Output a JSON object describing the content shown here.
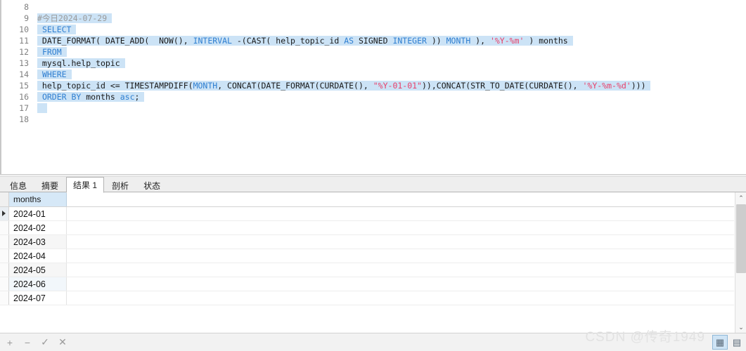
{
  "editor": {
    "first_line_number": 8,
    "lines": [
      {
        "num": 8,
        "selected": false,
        "tokens": []
      },
      {
        "num": 9,
        "selected": true,
        "tokens": [
          {
            "t": "#今日2024-07-29",
            "c": "comment"
          }
        ]
      },
      {
        "num": 10,
        "selected": true,
        "tokens": [
          {
            "t": " ",
            "c": "plain"
          },
          {
            "t": "SELECT",
            "c": "kw"
          }
        ]
      },
      {
        "num": 11,
        "selected": true,
        "tokens": [
          {
            "t": " DATE_FORMAT( DATE_ADD(  NOW(), ",
            "c": "plain"
          },
          {
            "t": "INTERVAL",
            "c": "kw"
          },
          {
            "t": " -(CAST( help_topic_id ",
            "c": "plain"
          },
          {
            "t": "AS",
            "c": "kw"
          },
          {
            "t": " SIGNED ",
            "c": "plain"
          },
          {
            "t": "INTEGER",
            "c": "kw"
          },
          {
            "t": " )) ",
            "c": "plain"
          },
          {
            "t": "MONTH",
            "c": "kw"
          },
          {
            "t": " ), ",
            "c": "plain"
          },
          {
            "t": "'%Y-%m'",
            "c": "str"
          },
          {
            "t": " ) months",
            "c": "plain"
          }
        ]
      },
      {
        "num": 12,
        "selected": true,
        "tokens": [
          {
            "t": " ",
            "c": "plain"
          },
          {
            "t": "FROM",
            "c": "kw"
          }
        ]
      },
      {
        "num": 13,
        "selected": true,
        "tokens": [
          {
            "t": " mysql.help_topic",
            "c": "plain"
          }
        ]
      },
      {
        "num": 14,
        "selected": true,
        "tokens": [
          {
            "t": " ",
            "c": "plain"
          },
          {
            "t": "WHERE",
            "c": "kw"
          }
        ]
      },
      {
        "num": 15,
        "selected": true,
        "tokens": [
          {
            "t": " help_topic_id <= TIMESTAMPDIFF(",
            "c": "plain"
          },
          {
            "t": "MONTH",
            "c": "kw"
          },
          {
            "t": ", CONCAT(DATE_FORMAT(CURDATE(), ",
            "c": "plain"
          },
          {
            "t": "\"%Y-01-01\"",
            "c": "str"
          },
          {
            "t": ")),CONCAT(STR_TO_DATE(CURDATE(), ",
            "c": "plain"
          },
          {
            "t": "'%Y-%m-%d'",
            "c": "str"
          },
          {
            "t": ")))",
            "c": "plain"
          }
        ]
      },
      {
        "num": 16,
        "selected": true,
        "tokens": [
          {
            "t": " ",
            "c": "plain"
          },
          {
            "t": "ORDER BY",
            "c": "kw"
          },
          {
            "t": " months ",
            "c": "plain"
          },
          {
            "t": "asc",
            "c": "kw"
          },
          {
            "t": ";",
            "c": "plain"
          }
        ]
      },
      {
        "num": 17,
        "selected": true,
        "tokens": []
      },
      {
        "num": 18,
        "selected": false,
        "tokens": []
      }
    ]
  },
  "tabs": [
    {
      "label": "信息",
      "active": false
    },
    {
      "label": "摘要",
      "active": false
    },
    {
      "label": "结果 1",
      "active": true
    },
    {
      "label": "剖析",
      "active": false
    },
    {
      "label": "状态",
      "active": false
    }
  ],
  "result_grid": {
    "columns": [
      "months"
    ],
    "rows": [
      {
        "values": [
          "2024-01"
        ],
        "current": true
      },
      {
        "values": [
          "2024-02"
        ],
        "current": false
      },
      {
        "values": [
          "2024-03"
        ],
        "current": false
      },
      {
        "values": [
          "2024-04"
        ],
        "current": false
      },
      {
        "values": [
          "2024-05"
        ],
        "current": false
      },
      {
        "values": [
          "2024-06"
        ],
        "current": false
      },
      {
        "values": [
          "2024-07"
        ],
        "current": false
      }
    ]
  },
  "bottom_bar": {
    "buttons": [
      {
        "name": "add-record-button",
        "glyph": "+"
      },
      {
        "name": "delete-record-button",
        "glyph": "−"
      },
      {
        "name": "apply-changes-button",
        "glyph": "✓"
      },
      {
        "name": "cancel-changes-button",
        "glyph": "✕"
      }
    ],
    "view_toggles": [
      {
        "name": "grid-view-toggle",
        "glyph": "▦",
        "selected": true
      },
      {
        "name": "form-view-toggle",
        "glyph": "▤",
        "selected": false
      }
    ]
  },
  "scrollbar": {
    "up_arrow_glyph": "⌃",
    "down_arrow_glyph": "⌄"
  },
  "watermark": {
    "text": "CSDN @传奇1949"
  },
  "colors": {
    "selection": "#cce3f6",
    "keyword": "#2f7fd1",
    "string": "#e8406a",
    "comment": "#9a9a9a",
    "column_header": "#d6e8f7"
  }
}
